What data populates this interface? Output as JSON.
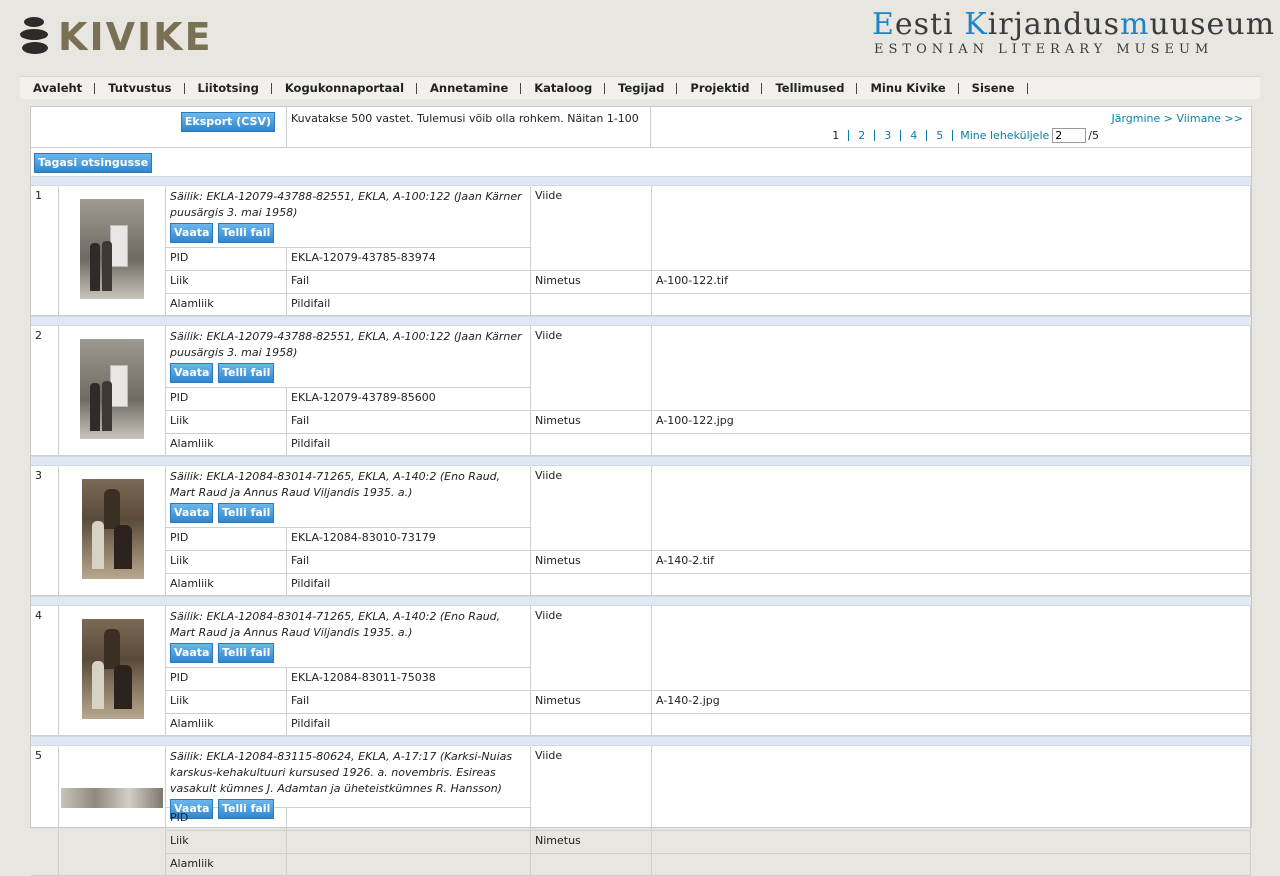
{
  "header": {
    "logo_text": "KIVIKE",
    "museum_et": "Eesti Kirjandusmuuseum",
    "museum_en": "Estonian Literary Museum"
  },
  "nav": [
    "Avaleht",
    "Tutvustus",
    "Liitotsing",
    "Kogukonnaportaal",
    "Annetamine",
    "Kataloog",
    "Tegijad",
    "Projektid",
    "Tellimused",
    "Minu Kivike",
    "Sisene"
  ],
  "toolbar": {
    "export_label": "Eksport (CSV)",
    "info": "Kuvatakse 500 vastet. Tulemusi võib olla rohkem. Näitan 1-100",
    "next_last": "Järgmine > Viimane >>",
    "pages": [
      "1",
      "2",
      "3",
      "4",
      "5"
    ],
    "goto_label": "Mine leheküljele",
    "goto_value": "2",
    "total_pages": "/5",
    "back_label": "Tagasi otsingusse"
  },
  "labels": {
    "view": "Vaata",
    "order": "Telli fail",
    "viide": "Viide",
    "pid": "PID",
    "liik": "Liik",
    "nimetus": "Nimetus",
    "alamliik": "Alamliik"
  },
  "records": [
    {
      "num": "1",
      "title": "Säilik: EKLA-12079-43788-82551, EKLA, A-100:122 (Jaan Kärner puusärgis 3. mai 1958)",
      "pid": "EKLA-12079-43785-83974",
      "liik": "Fail",
      "nimetus": "A-100-122.tif",
      "alamliik": "Pildifail"
    },
    {
      "num": "2",
      "title": "Säilik: EKLA-12079-43788-82551, EKLA, A-100:122 (Jaan Kärner puusärgis 3. mai 1958)",
      "pid": "EKLA-12079-43789-85600",
      "liik": "Fail",
      "nimetus": "A-100-122.jpg",
      "alamliik": "Pildifail"
    },
    {
      "num": "3",
      "title": "Säilik: EKLA-12084-83014-71265, EKLA, A-140:2 (Eno Raud, Mart Raud ja Annus Raud Viljandis 1935. a.)",
      "pid": "EKLA-12084-83010-73179",
      "liik": "Fail",
      "nimetus": "A-140-2.tif",
      "alamliik": "Pildifail"
    },
    {
      "num": "4",
      "title": "Säilik: EKLA-12084-83014-71265, EKLA, A-140:2 (Eno Raud, Mart Raud ja Annus Raud Viljandis 1935. a.)",
      "pid": "EKLA-12084-83011-75038",
      "liik": "Fail",
      "nimetus": "A-140-2.jpg",
      "alamliik": "Pildifail"
    },
    {
      "num": "5",
      "title": "Säilik: EKLA-12084-83115-80624, EKLA, A-17:17 (Karksi-Nuias karskus-kehakultuuri kursused 1926. a. novembris. Esireas vasakult kümnes J. Adamtan ja üheteistkümnes R. Hansson)",
      "pid": "",
      "liik": "",
      "nimetus": "",
      "alamliik": ""
    }
  ]
}
